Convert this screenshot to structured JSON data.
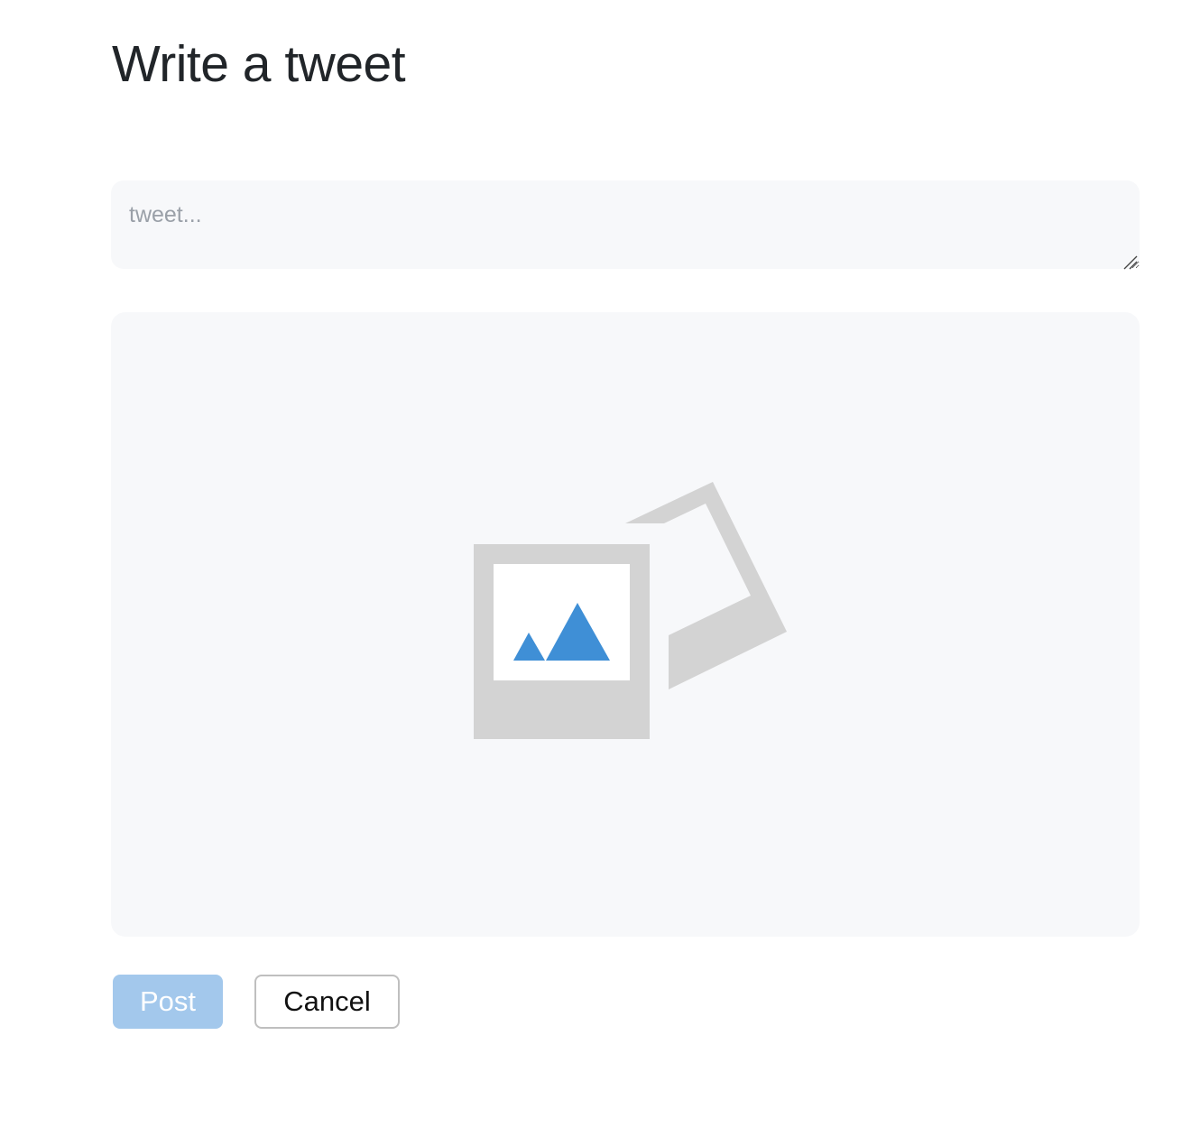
{
  "page": {
    "title": "Write a tweet"
  },
  "compose": {
    "tweet_value": "",
    "tweet_placeholder": "tweet..."
  },
  "image_upload": {
    "icon": "photo-placeholder-icon",
    "colors": {
      "background": "#f7f8fa",
      "frame": "#d3d3d3",
      "mountains": "#3f8fd6"
    }
  },
  "actions": {
    "post_label": "Post",
    "cancel_label": "Cancel"
  },
  "colors": {
    "post_button_disabled": "#a3c8ec",
    "title_text": "#212529",
    "placeholder_text": "#9aa0a8"
  }
}
